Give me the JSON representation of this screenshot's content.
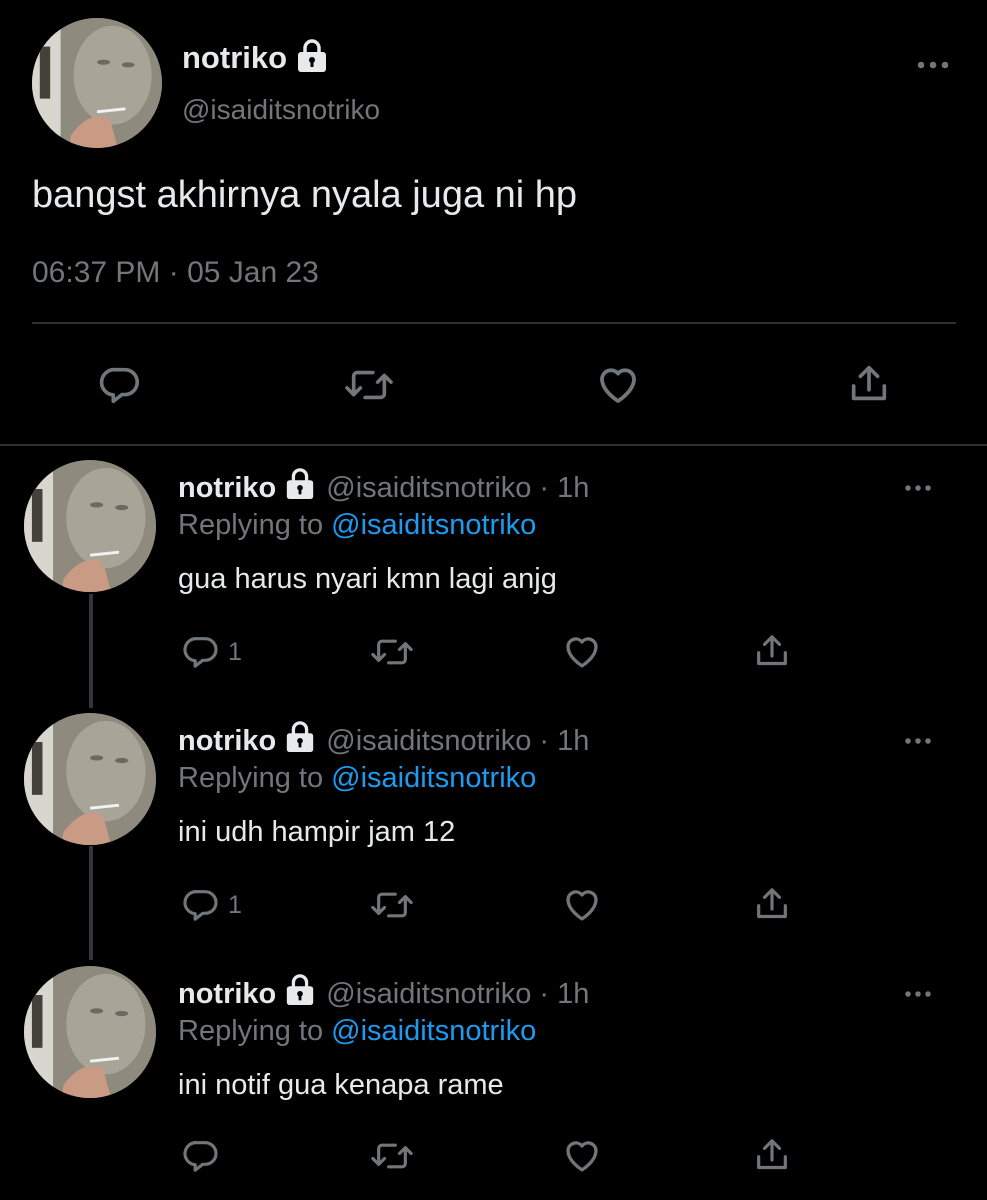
{
  "main_tweet": {
    "display_name": "notriko",
    "handle": "@isaiditsnotriko",
    "text": "bangst akhirnya nyala juga ni hp",
    "timestamp": "06:37 PM · 05 Jan 23",
    "protected": true,
    "actions": [
      "reply-icon",
      "retweet-icon",
      "like-icon",
      "share-icon"
    ]
  },
  "replies": [
    {
      "display_name": "notriko",
      "handle": "@isaiditsnotriko",
      "time": "· 1h",
      "replying_prefix": "Replying to",
      "replying_to": "@isaiditsnotriko",
      "text": "gua harus nyari kmn lagi anjg",
      "reply_count": "1"
    },
    {
      "display_name": "notriko",
      "handle": "@isaiditsnotriko",
      "time": "· 1h",
      "replying_prefix": "Replying to",
      "replying_to": "@isaiditsnotriko",
      "text": "ini udh hampir jam 12",
      "reply_count": "1"
    },
    {
      "display_name": "notriko",
      "handle": "@isaiditsnotriko",
      "time": "· 1h",
      "replying_prefix": "Replying to",
      "replying_to": "@isaiditsnotriko",
      "text": "ini notif gua kenapa rame",
      "reply_count": ""
    }
  ],
  "colors": {
    "background": "#000000",
    "text": "#e7e9ea",
    "muted": "#71767b",
    "link": "#1d9bf0",
    "divider": "#2f3336"
  }
}
